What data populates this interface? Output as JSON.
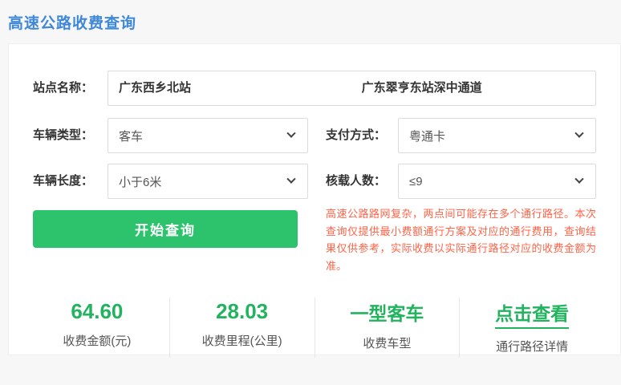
{
  "page": {
    "title": "高速公路收费查询"
  },
  "form": {
    "station": {
      "label": "站点名称：",
      "from_value": "广东西乡北站",
      "to_value": "广东翠亨东站深中通道"
    },
    "vehicle_type": {
      "label": "车辆类型：",
      "value": "客车"
    },
    "payment_method": {
      "label": "支付方式：",
      "value": "粤通卡"
    },
    "vehicle_length": {
      "label": "车辆长度：",
      "value": "小于6米"
    },
    "passenger_capacity": {
      "label": "核载人数：",
      "value": "≤9"
    },
    "submit_label": "开始查询",
    "notice": "高速公路路网复杂，两点间可能存在多个通行路径。本次查询仅提供最小费额通行方案及对应的通行费用，查询结果仅供参考，实际收费以实际通行路径对应的收费金额为准。"
  },
  "results": {
    "items": [
      {
        "value": "64.60",
        "label": "收费金额(元)"
      },
      {
        "value": "28.03",
        "label": "收费里程(公里)"
      },
      {
        "value": "一型客车",
        "label": "收费车型"
      },
      {
        "value": "点击查看",
        "label": "通行路径详情"
      }
    ]
  },
  "colors": {
    "accent_blue": "#3e87d9",
    "value_green": "#21b35e",
    "button_green": "#2dc26c",
    "notice_orange": "#ff6347"
  }
}
